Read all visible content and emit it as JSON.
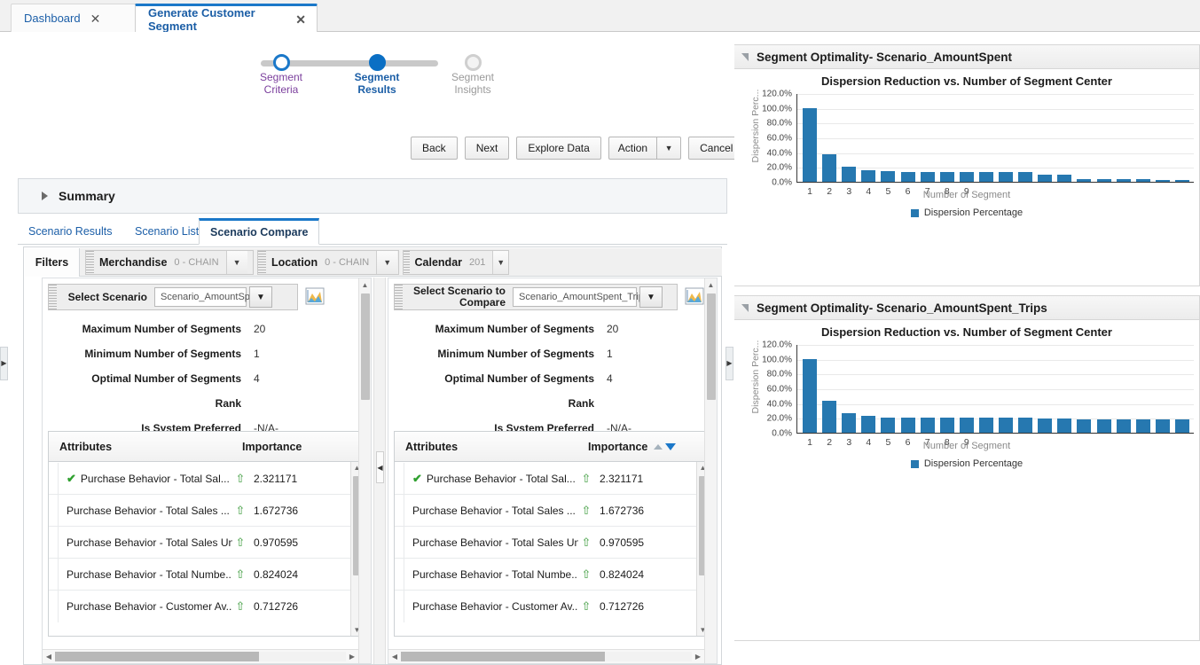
{
  "browser_tabs": [
    {
      "label": "Dashboard",
      "close": "✕",
      "active": false
    },
    {
      "label": "Generate Customer Segment",
      "close": "✕",
      "active": true
    }
  ],
  "train": {
    "steps": [
      {
        "line1": "Segment",
        "line2": "Criteria",
        "state": "visited"
      },
      {
        "line1": "Segment",
        "line2": "Results",
        "state": "current"
      },
      {
        "line1": "Segment",
        "line2": "Insights",
        "state": "future"
      }
    ]
  },
  "actions": {
    "back": "Back",
    "next": "Next",
    "explore_data": "Explore Data",
    "action": "Action",
    "action_arrow": "▼",
    "cancel": "Cancel"
  },
  "summary": {
    "label": "Summary",
    "expanded": false
  },
  "tabs": [
    {
      "label": "Scenario Results",
      "active": false
    },
    {
      "label": "Scenario List",
      "active": false
    },
    {
      "label": "Scenario Compare",
      "active": true
    }
  ],
  "filters": {
    "title": "Filters",
    "chips": [
      {
        "name": "Merchandise",
        "value": "0 - CHAIN",
        "arrow": "▼"
      },
      {
        "name": "Location",
        "value": "0 - CHAIN",
        "arrow": "▼"
      },
      {
        "name": "Calendar",
        "value": "201",
        "arrow": "▼"
      }
    ]
  },
  "pane_left": {
    "selector_label": "Select Scenario",
    "selector_value": "Scenario_AmountSpent",
    "selector_arrow": "▼",
    "fields": [
      {
        "key": "Maximum Number of Segments",
        "value": "20"
      },
      {
        "key": "Minimum Number of Segments",
        "value": "1"
      },
      {
        "key": "Optimal Number of Segments",
        "value": "4"
      },
      {
        "key": "Rank",
        "value": ""
      },
      {
        "key": "Is System Preferred",
        "value": "-N/A-"
      }
    ],
    "table": {
      "columns": [
        "Attributes",
        "Importance"
      ],
      "sorted": false,
      "rows": [
        {
          "checked": true,
          "name": "Purchase Behavior - Total Sal...",
          "trend": "⇧",
          "importance": "2.321171"
        },
        {
          "checked": false,
          "name": "Purchase Behavior - Total Sales ...",
          "trend": "⇧",
          "importance": "1.672736"
        },
        {
          "checked": false,
          "name": "Purchase Behavior - Total Sales Unit",
          "trend": "⇧",
          "importance": "0.970595"
        },
        {
          "checked": false,
          "name": "Purchase Behavior - Total Numbe...",
          "trend": "⇧",
          "importance": "0.824024"
        },
        {
          "checked": false,
          "name": "Purchase Behavior - Customer Av...",
          "trend": "⇧",
          "importance": "0.712726"
        }
      ]
    }
  },
  "pane_right": {
    "selector_label": "Select Scenario to Compare",
    "selector_value": "Scenario_AmountSpent_Trips",
    "selector_arrow": "▼",
    "fields": [
      {
        "key": "Maximum Number of Segments",
        "value": "20"
      },
      {
        "key": "Minimum Number of Segments",
        "value": "1"
      },
      {
        "key": "Optimal Number of Segments",
        "value": "4"
      },
      {
        "key": "Rank",
        "value": ""
      },
      {
        "key": "Is System Preferred",
        "value": "-N/A-"
      }
    ],
    "table": {
      "columns": [
        "Attributes",
        "Importance"
      ],
      "sorted": true,
      "rows": [
        {
          "checked": true,
          "name": "Purchase Behavior - Total Sal...",
          "trend": "⇧",
          "importance": "2.321171"
        },
        {
          "checked": false,
          "name": "Purchase Behavior - Total Sales ...",
          "trend": "⇧",
          "importance": "1.672736"
        },
        {
          "checked": false,
          "name": "Purchase Behavior - Total Sales Unit",
          "trend": "⇧",
          "importance": "0.970595"
        },
        {
          "checked": false,
          "name": "Purchase Behavior - Total Numbe...",
          "trend": "⇧",
          "importance": "0.824024"
        },
        {
          "checked": false,
          "name": "Purchase Behavior - Customer Av...",
          "trend": "⇧",
          "importance": "0.712726"
        }
      ]
    }
  },
  "panels": [
    {
      "title": "Segment Optimality- Scenario_AmountSpent"
    },
    {
      "title": "Segment Optimality- Scenario_AmountSpent_Trips"
    }
  ],
  "colors": {
    "bar": "#2678b0",
    "accent": "#1b78c9",
    "step_visited": "#7b3f9d",
    "step_current": "#1b5ea6",
    "check_green": "#2fa02f"
  },
  "chart_data": [
    {
      "type": "bar",
      "title": "Dispersion Reduction vs. Number of Segment Center",
      "xlabel": "Number of Segment",
      "ylabel": "Dispersion Perc...",
      "legend": [
        "Dispersion Percentage"
      ],
      "legend_position": "bottom",
      "grid": true,
      "ylim": [
        0,
        120
      ],
      "yticks": [
        "0.0%",
        "20.0%",
        "40.0%",
        "60.0%",
        "80.0%",
        "100.0%",
        "120.0%"
      ],
      "ytick_values": [
        0,
        20,
        40,
        60,
        80,
        100,
        120
      ],
      "categories": [
        "1",
        "2",
        "3",
        "4",
        "5",
        "6",
        "7",
        "8",
        "9",
        "",
        "",
        "",
        "",
        "",
        "",
        "",
        "",
        "",
        "",
        ""
      ],
      "visible_xticks": [
        "1",
        "2",
        "3",
        "4",
        "5",
        "6",
        "7",
        "8",
        "9"
      ],
      "values": [
        100,
        37,
        20,
        16,
        14,
        13,
        13,
        13,
        13,
        13,
        13,
        13,
        10,
        10,
        4,
        4,
        4,
        4,
        3,
        3
      ]
    },
    {
      "type": "bar",
      "title": "Dispersion Reduction vs. Number of Segment Center",
      "xlabel": "Number of Segment",
      "ylabel": "Dispersion Perc...",
      "legend": [
        "Dispersion Percentage"
      ],
      "legend_position": "bottom",
      "grid": true,
      "ylim": [
        0,
        120
      ],
      "yticks": [
        "0.0%",
        "20.0%",
        "40.0%",
        "60.0%",
        "80.0%",
        "100.0%",
        "120.0%"
      ],
      "ytick_values": [
        0,
        20,
        40,
        60,
        80,
        100,
        120
      ],
      "categories": [
        "1",
        "2",
        "3",
        "4",
        "5",
        "6",
        "7",
        "8",
        "9",
        "",
        "",
        "",
        "",
        "",
        "",
        "",
        "",
        "",
        "",
        ""
      ],
      "visible_xticks": [
        "1",
        "2",
        "3",
        "4",
        "5",
        "6",
        "7",
        "8",
        "9"
      ],
      "values": [
        100,
        43,
        26,
        23,
        21,
        21,
        21,
        21,
        21,
        21,
        20,
        20,
        19,
        19,
        18,
        18,
        18,
        18,
        18,
        18
      ]
    }
  ]
}
